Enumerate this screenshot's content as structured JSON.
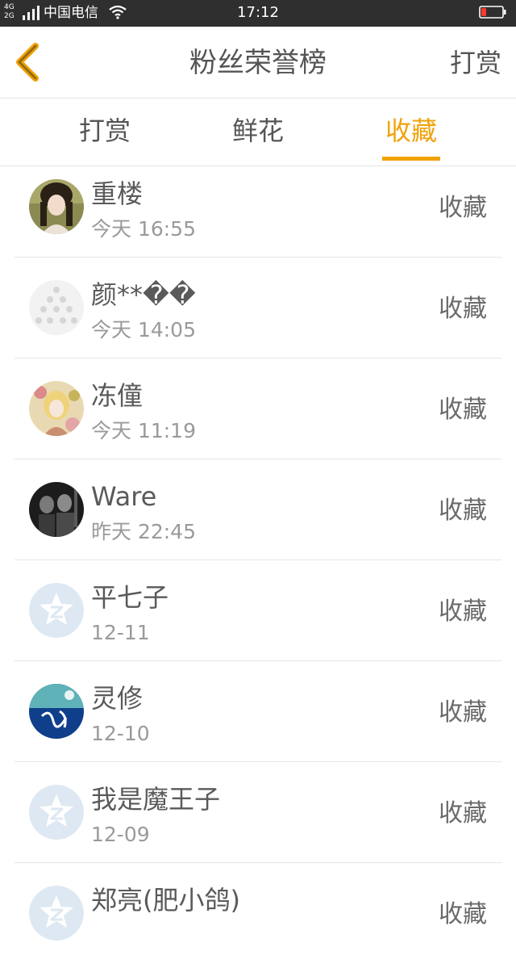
{
  "status_bar": {
    "network_top": "4G",
    "network_bottom": "2G",
    "carrier": "中国电信",
    "time": "17:12",
    "icons": [
      "signal-icon",
      "wifi-icon",
      "battery-low-icon"
    ]
  },
  "header": {
    "back_icon": "chevron-left-icon",
    "title": "粉丝荣誉榜",
    "action_label": "打赏"
  },
  "tabs": [
    {
      "label": "打赏",
      "active": false
    },
    {
      "label": "鲜花",
      "active": false
    },
    {
      "label": "收藏",
      "active": true
    }
  ],
  "colors": {
    "accent": "#f0a20a",
    "text": "#555555",
    "subtext": "#9a9a9a",
    "divider": "#e6e6e6",
    "status_bar": "#2f2f2f"
  },
  "fans": [
    {
      "name": "重楼",
      "time": "今天 16:55",
      "action": "收藏",
      "avatar": "girl-portrait-avatar"
    },
    {
      "name": "颜**��",
      "time": "今天 14:05",
      "action": "收藏",
      "avatar": "faded-photo-avatar"
    },
    {
      "name": "冻僮",
      "time": "今天 11:19",
      "action": "收藏",
      "avatar": "anime-girl-avatar"
    },
    {
      "name": "Ware",
      "time": "昨天 22:45",
      "action": "收藏",
      "avatar": "dark-photo-avatar"
    },
    {
      "name": "平七子",
      "time": "12-11",
      "action": "收藏",
      "avatar": "default-qq-avatar"
    },
    {
      "name": "灵修",
      "time": "12-10",
      "action": "收藏",
      "avatar": "blue-calligraphy-avatar"
    },
    {
      "name": "我是魔王子",
      "time": "12-09",
      "action": "收藏",
      "avatar": "default-qq-avatar"
    },
    {
      "name": "郑亮(肥小鸽)",
      "time": "",
      "action": "收藏",
      "avatar": "default-qq-avatar"
    }
  ]
}
